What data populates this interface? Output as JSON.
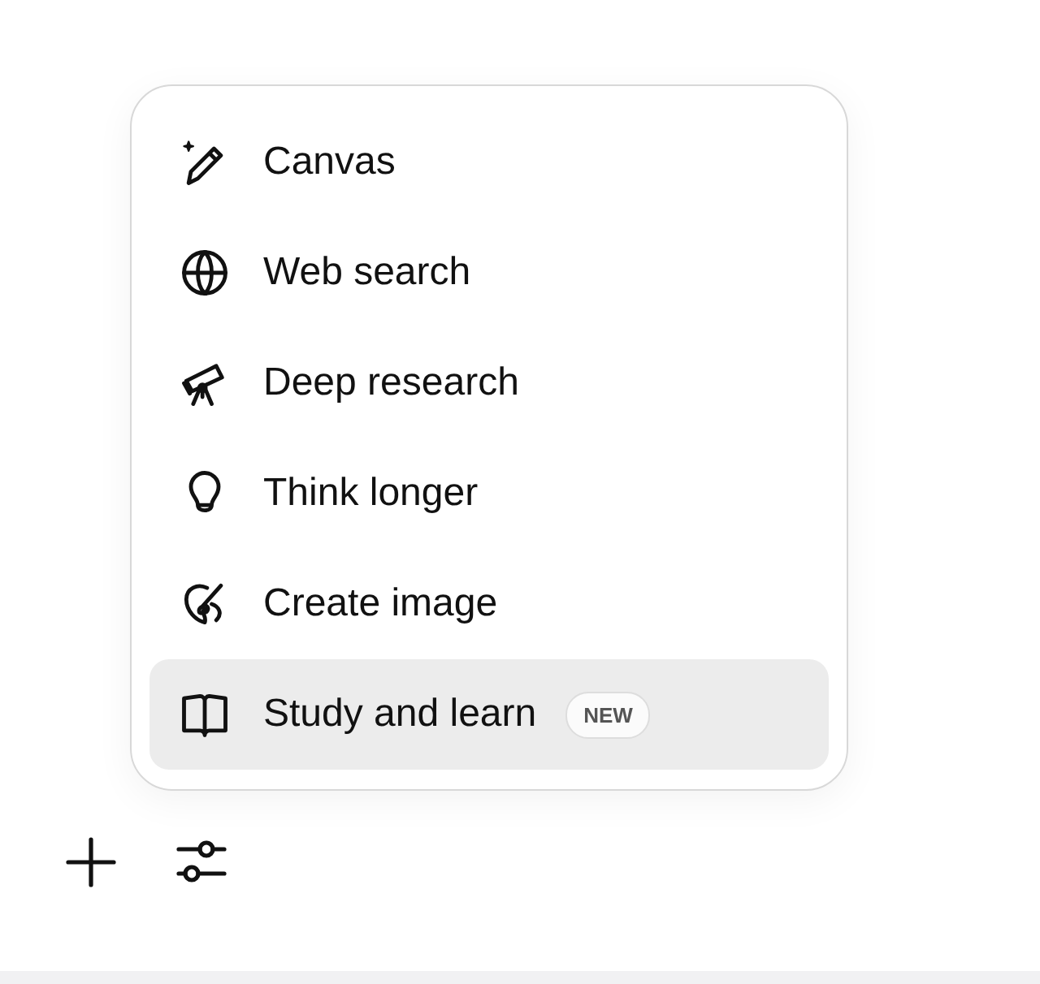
{
  "menu": {
    "items": [
      {
        "kind": "canvas",
        "label": "Canvas",
        "selected": false
      },
      {
        "kind": "globe",
        "label": "Web search",
        "selected": false
      },
      {
        "kind": "telescope",
        "label": "Deep research",
        "selected": false
      },
      {
        "kind": "bulb",
        "label": "Think longer",
        "selected": false
      },
      {
        "kind": "palette",
        "label": "Create image",
        "selected": false
      },
      {
        "kind": "book",
        "label": "Study and learn",
        "selected": true,
        "badge": "NEW"
      }
    ]
  }
}
